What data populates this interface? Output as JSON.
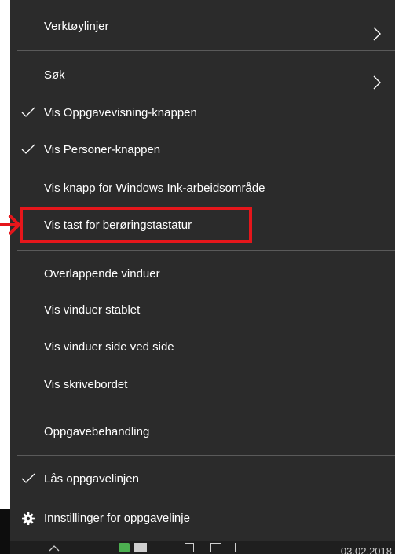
{
  "menu": {
    "items": [
      {
        "label": "Verktøylinjer",
        "checked": false,
        "submenu": true
      },
      {
        "label": "Søk",
        "checked": false,
        "submenu": true
      },
      {
        "label": "Vis Oppgavevisning-knappen",
        "checked": true,
        "submenu": false
      },
      {
        "label": "Vis Personer-knappen",
        "checked": true,
        "submenu": false
      },
      {
        "label": "Vis knapp for Windows Ink-arbeidsområde",
        "checked": false,
        "submenu": false
      },
      {
        "label": "Vis tast for berøringstastatur",
        "checked": false,
        "submenu": false,
        "highlighted": true
      },
      {
        "label": "Overlappende vinduer",
        "checked": false,
        "submenu": false
      },
      {
        "label": "Vis vinduer stablet",
        "checked": false,
        "submenu": false
      },
      {
        "label": "Vis vinduer side ved side",
        "checked": false,
        "submenu": false
      },
      {
        "label": "Vis skrivebordet",
        "checked": false,
        "submenu": false
      },
      {
        "label": "Oppgavebehandling",
        "checked": false,
        "submenu": false
      },
      {
        "label": "Lås oppgavelinjen",
        "checked": true,
        "submenu": false
      },
      {
        "label": "Innstillinger for oppgavelinje",
        "checked": false,
        "submenu": false,
        "icon": "gear-icon"
      }
    ]
  },
  "taskbar": {
    "date": "03.02.2018"
  },
  "colors": {
    "menu_background": "#2b2b2b",
    "menu_text": "#ffffff",
    "separator": "#5a5a5a",
    "annotation_red": "#e5161b"
  }
}
